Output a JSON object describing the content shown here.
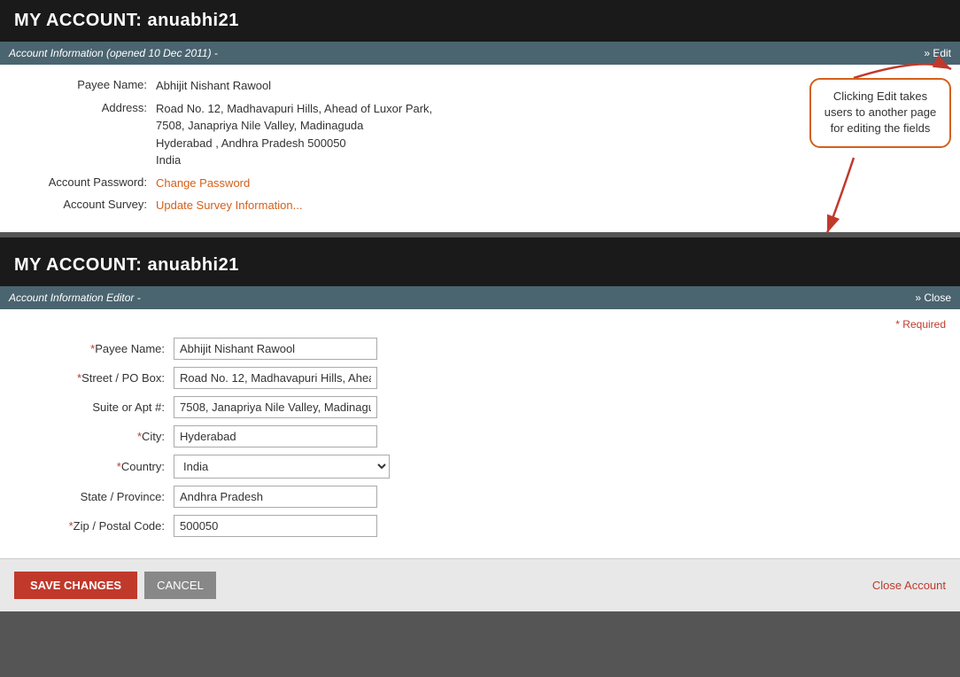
{
  "page": {
    "title1": "MY ACCOUNT: anuabhi21",
    "title2": "MY ACCOUNT: anuabhi21"
  },
  "section1": {
    "header": "Account Information (opened 10 Dec 2011) -",
    "edit_link": "» Edit",
    "payee_label": "Payee Name:",
    "payee_value": "Abhijit Nishant Rawool",
    "address_label": "Address:",
    "address_line1": "Road No. 12, Madhavapuri Hills, Ahead of Luxor Park,",
    "address_line2": "7508, Janapriya Nile Valley, Madinaguda",
    "address_line3": "Hyderabad , Andhra Pradesh 500050",
    "address_line4": "India",
    "password_label": "Account Password:",
    "password_link": "Change Password",
    "survey_label": "Account Survey:",
    "survey_link": "Update Survey Information...",
    "annotation_text": "Clicking Edit takes users to another page for editing the fields"
  },
  "section2": {
    "header": "Account Information Editor -",
    "close_link": "» Close",
    "required_note": "* Required",
    "fields": {
      "payee_label": "*Payee Name:",
      "payee_value": "Abhijit Nishant Rawool",
      "street_label": "*Street / PO Box:",
      "street_value": "Road No. 12, Madhavapuri Hills, Ahea",
      "suite_label": "Suite or Apt #:",
      "suite_value": "7508, Janapriya Nile Valley, Madinagu",
      "city_label": "*City:",
      "city_value": "Hyderabad",
      "country_label": "*Country:",
      "country_value": "India",
      "state_label": "State / Province:",
      "state_value": "Andhra Pradesh",
      "zip_label": "*Zip / Postal Code:",
      "zip_value": "500050"
    }
  },
  "buttons": {
    "save": "SAVE CHANGES",
    "cancel": "CANCEL",
    "close_account": "Close Account"
  }
}
